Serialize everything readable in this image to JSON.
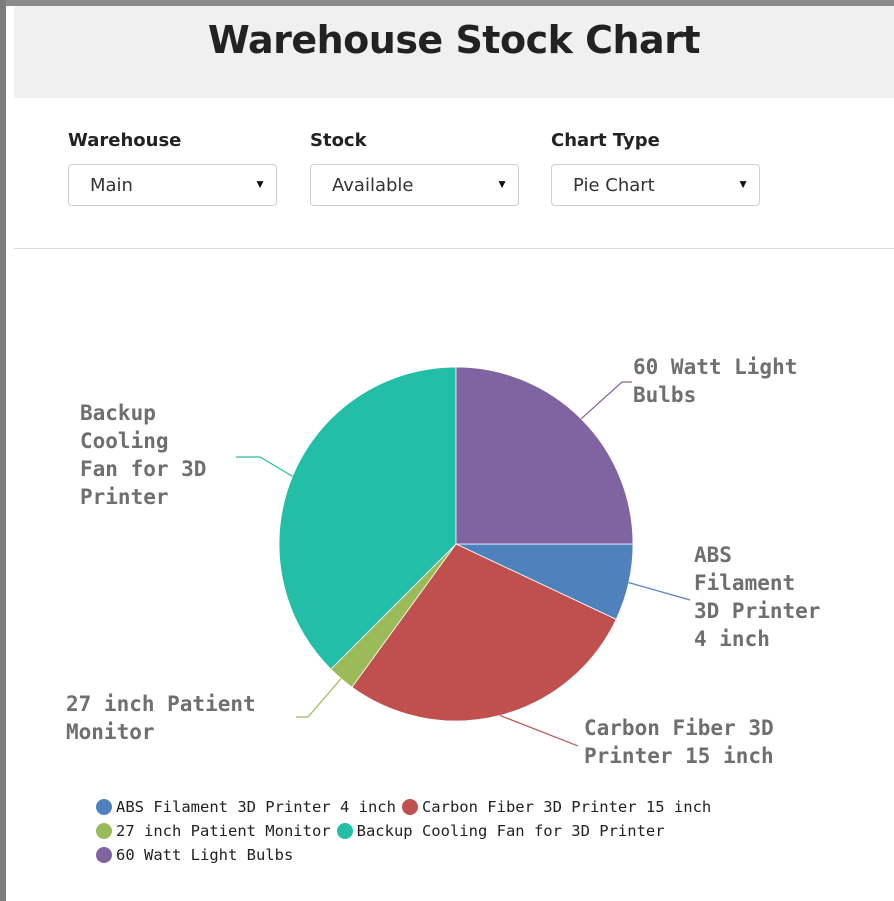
{
  "title": "Warehouse Stock Chart",
  "controls": [
    {
      "label": "Warehouse",
      "value": "Main"
    },
    {
      "label": "Stock",
      "value": "Available"
    },
    {
      "label": "Chart Type",
      "value": "Pie Chart"
    }
  ],
  "chart_data": {
    "type": "pie",
    "title": "",
    "slices": [
      {
        "name": "ABS Filament 3D Printer 4 inch",
        "value": 7,
        "color": "#4f81bd"
      },
      {
        "name": "Carbon Fiber 3D Printer 15 inch",
        "value": 28,
        "color": "#c0504d"
      },
      {
        "name": "27 inch Patient Monitor",
        "value": 2.5,
        "color": "#9bbb59"
      },
      {
        "name": "Backup Cooling Fan for 3D Printer",
        "value": 37.5,
        "color": "#23bea8"
      },
      {
        "name": "60 Watt Light Bulbs",
        "value": 25,
        "color": "#8064a2"
      }
    ],
    "callout_labels": [
      [
        "ABS",
        "Filament",
        "3D Printer",
        "4 inch"
      ],
      [
        "Carbon Fiber 3D",
        "Printer 15 inch"
      ],
      [
        "27 inch Patient",
        "Monitor"
      ],
      [
        "Backup",
        "Cooling",
        "Fan for 3D",
        "Printer"
      ],
      [
        "60 Watt Light",
        "Bulbs"
      ]
    ],
    "legend_position": "bottom",
    "legend_rows": [
      [
        0,
        1
      ],
      [
        2,
        3
      ],
      [
        4
      ]
    ]
  }
}
